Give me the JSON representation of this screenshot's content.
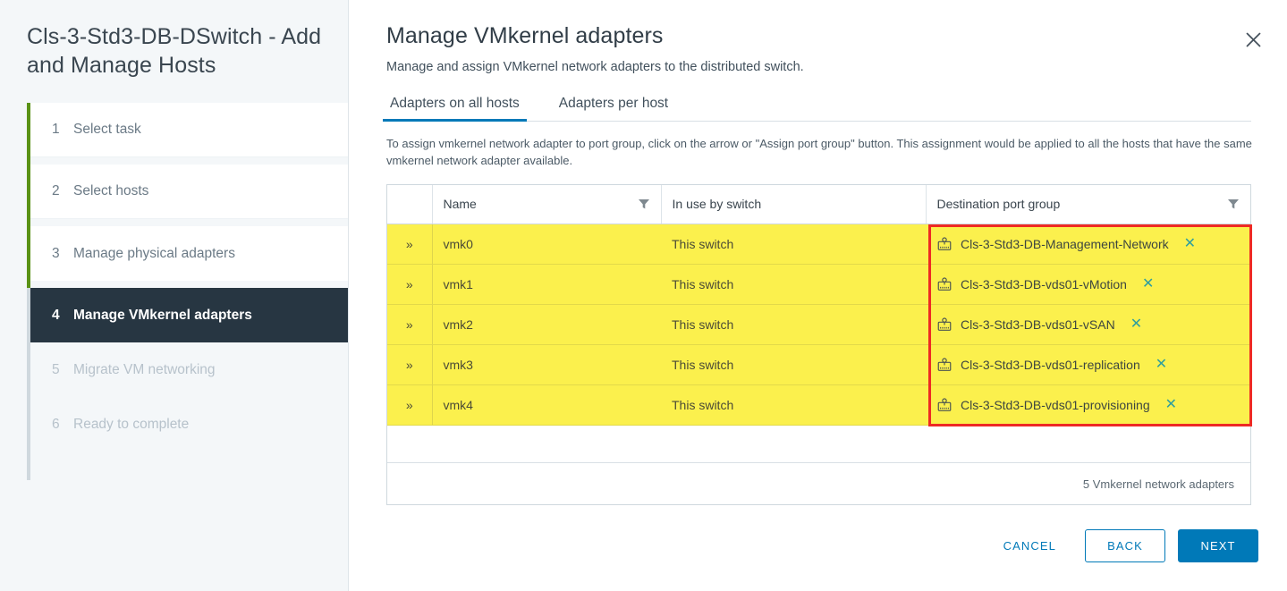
{
  "wizard": {
    "title": "Cls-3-Std3-DB-DSwitch - Add and Manage Hosts",
    "steps": [
      {
        "num": "1",
        "label": "Select task",
        "state": "done"
      },
      {
        "num": "2",
        "label": "Select hosts",
        "state": "done"
      },
      {
        "num": "3",
        "label": "Manage physical adapters",
        "state": "done"
      },
      {
        "num": "4",
        "label": "Manage VMkernel adapters",
        "state": "active"
      },
      {
        "num": "5",
        "label": "Migrate VM networking",
        "state": "disabled"
      },
      {
        "num": "6",
        "label": "Ready to complete",
        "state": "disabled"
      }
    ]
  },
  "header": {
    "title": "Manage VMkernel adapters",
    "subtitle": "Manage and assign VMkernel network adapters to the distributed switch.",
    "close_label": "✕"
  },
  "tabs": [
    {
      "label": "Adapters on all hosts",
      "active": true
    },
    {
      "label": "Adapters per host",
      "active": false
    }
  ],
  "instructions": "To assign vmkernel network adapter to port group, click on the arrow or \"Assign port group\" button. This assignment would be applied to all the hosts that have the same vmkernel network adapter available.",
  "table": {
    "columns": [
      "",
      "Name",
      "In use by switch",
      "Destination port group"
    ],
    "handle_glyph": "»",
    "remove_glyph": "✕",
    "rows": [
      {
        "name": "vmk0",
        "in_use": "This switch",
        "dest": "Cls-3-Std3-DB-Management-Network"
      },
      {
        "name": "vmk1",
        "in_use": "This switch",
        "dest": "Cls-3-Std3-DB-vds01-vMotion"
      },
      {
        "name": "vmk2",
        "in_use": "This switch",
        "dest": "Cls-3-Std3-DB-vds01-vSAN"
      },
      {
        "name": "vmk3",
        "in_use": "This switch",
        "dest": "Cls-3-Std3-DB-vds01-replication"
      },
      {
        "name": "vmk4",
        "in_use": "This switch",
        "dest": "Cls-3-Std3-DB-vds01-provisioning"
      }
    ],
    "footer_count": "5 Vmkernel network adapters"
  },
  "actions": {
    "cancel": "CANCEL",
    "back": "BACK",
    "next": "NEXT"
  },
  "colors": {
    "accent_blue": "#0079b8",
    "step_done_green": "#5a9216",
    "active_step_bg": "#273642",
    "row_highlight_yellow": "#fbf04d",
    "attention_red": "#ee2a24",
    "remove_teal": "#2f9e9e"
  }
}
